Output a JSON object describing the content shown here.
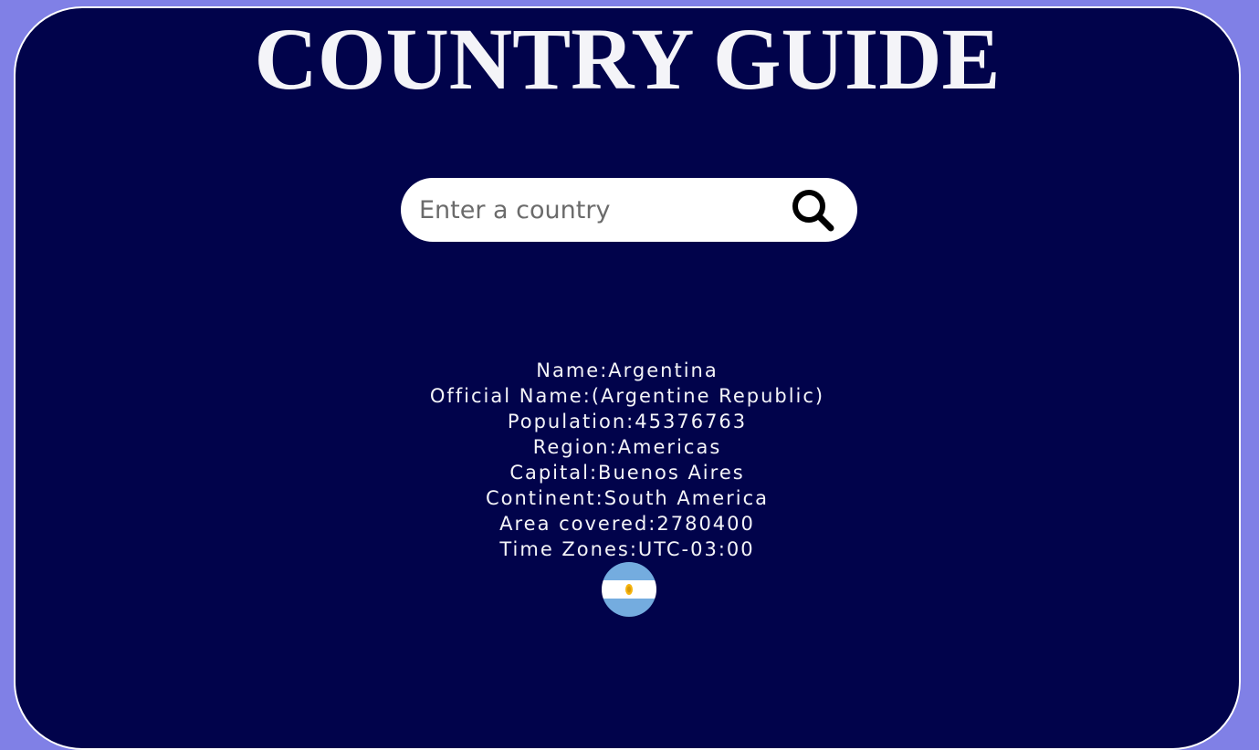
{
  "header": {
    "title": "COUNTRY GUIDE"
  },
  "search": {
    "placeholder": "Enter a country",
    "value": "",
    "icon": "search-icon"
  },
  "country": {
    "name_label": "Name:",
    "name": "Argentina",
    "official_name_label": "Official Name:",
    "official_name": "(Argentine Republic)",
    "population_label": "Population:",
    "population": "45376763",
    "region_label": "Region:",
    "region": "Americas",
    "capital_label": "Capital:",
    "capital": "Buenos Aires",
    "continent_label": "Continent:",
    "continent": "South America",
    "area_label": "Area covered:",
    "area": "2780400",
    "timezones_label": "Time Zones:",
    "timezones": "UTC-03:00",
    "flag_icon": "argentina-flag-icon"
  },
  "colors": {
    "page_background": "#8080e6",
    "card_background": "#01034b",
    "text": "#f4f4f8",
    "flag_blue": "#74acdf",
    "flag_white": "#ffffff",
    "flag_sun": "#f6b40e"
  }
}
